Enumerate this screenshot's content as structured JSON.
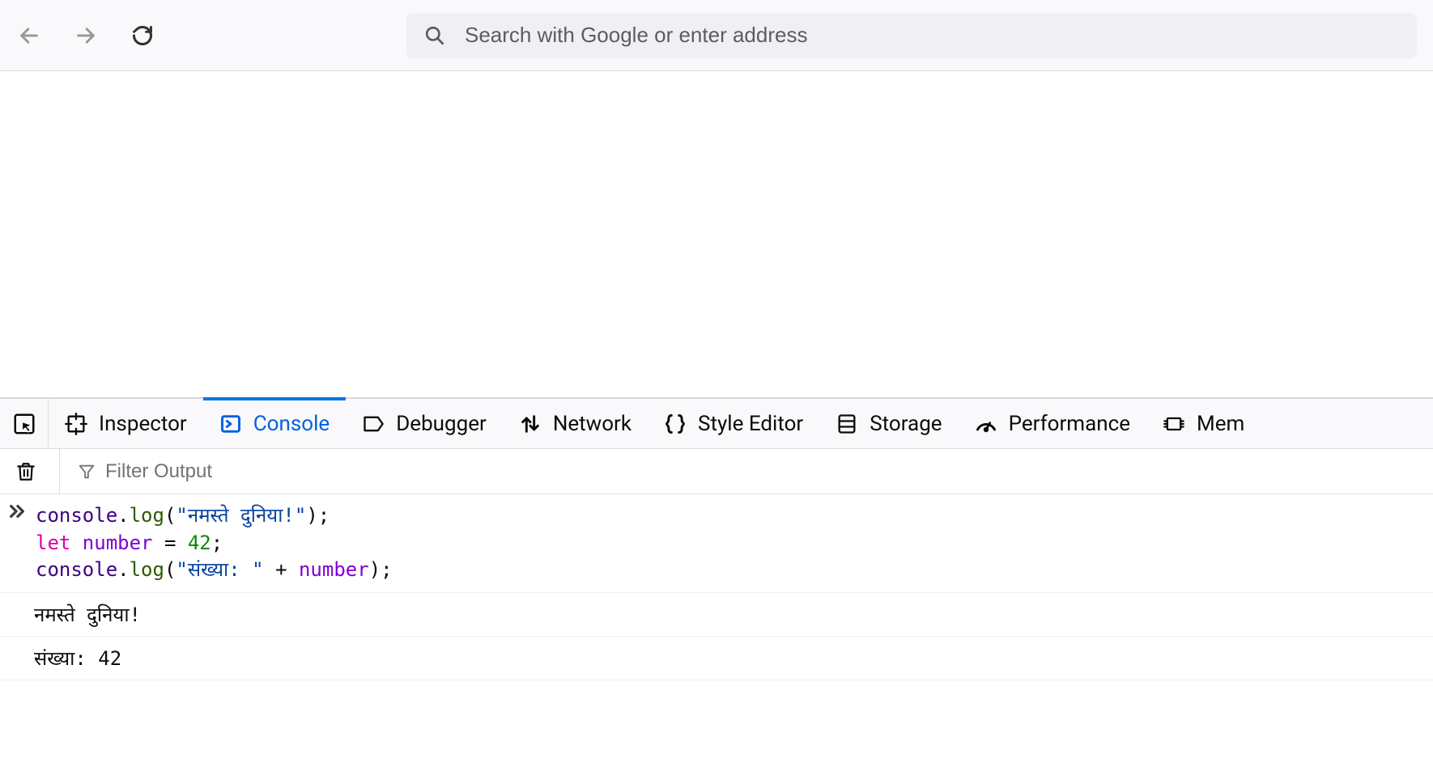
{
  "browser": {
    "address_placeholder": "Search with Google or enter address"
  },
  "devtools": {
    "tabs": {
      "inspector": "Inspector",
      "console": "Console",
      "debugger": "Debugger",
      "network": "Network",
      "style_editor": "Style Editor",
      "storage": "Storage",
      "performance": "Performance",
      "memory": "Mem"
    }
  },
  "console": {
    "filter_placeholder": "Filter Output",
    "code": {
      "line1": {
        "obj": "console",
        "dot": ".",
        "method": "log",
        "open": "(",
        "string": "\"नमस्ते दुनिया!\"",
        "close": ")",
        "semi": ";"
      },
      "line2": {
        "keyword": "let ",
        "var": "number",
        "eq": " = ",
        "num": "42",
        "semi": ";"
      },
      "line3": {
        "obj": "console",
        "dot": ".",
        "method": "log",
        "open": "(",
        "string": "\"संख्या: \"",
        "plus": " + ",
        "var": "number",
        "close": ")",
        "semi": ";"
      }
    },
    "output": {
      "line1": "नमस्ते दुनिया!",
      "line2": "संख्या: 42"
    }
  }
}
